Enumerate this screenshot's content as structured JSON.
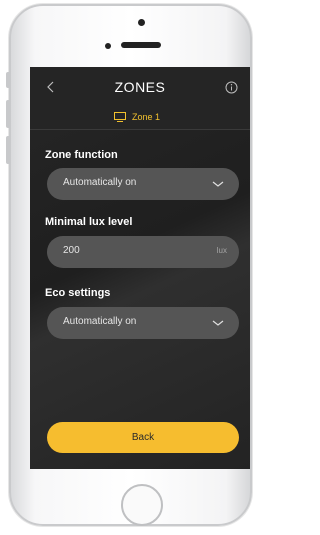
{
  "header": {
    "title": "ZONES",
    "zone_label": "Zone 1"
  },
  "sections": {
    "zone_function": {
      "label": "Zone function",
      "value": "Automatically on"
    },
    "minimal_lux": {
      "label": "Minimal lux level",
      "value": "200",
      "unit": "lux"
    },
    "eco_settings": {
      "label": "Eco settings",
      "value": "Automatically on"
    }
  },
  "footer": {
    "back_label": "Back"
  },
  "icons": {
    "back": "chevron-left-icon",
    "info": "info-icon",
    "zone": "monitor-icon",
    "dropdown": "chevron-down-icon"
  },
  "colors": {
    "accent": "#f6bd2f",
    "screen_bg": "#252525",
    "field_bg": "#555555"
  }
}
